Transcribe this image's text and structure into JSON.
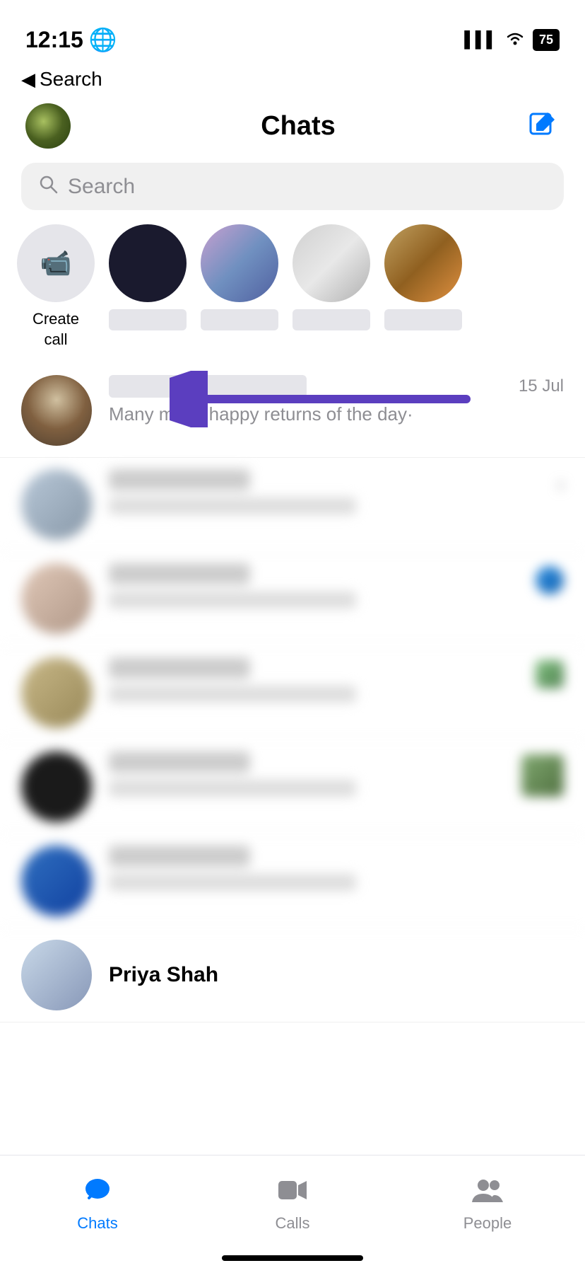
{
  "statusBar": {
    "time": "12:15",
    "globeIcon": "🌐",
    "battery": "75"
  },
  "backButton": {
    "label": "Search"
  },
  "header": {
    "title": "Chats",
    "composeLabel": "compose"
  },
  "searchBar": {
    "placeholder": "Search"
  },
  "storyRow": {
    "createCall": {
      "label": "Create\ncall"
    },
    "stories": [
      {
        "id": 1,
        "colorClass": "av1"
      },
      {
        "id": 2,
        "colorClass": "av2"
      },
      {
        "id": 3,
        "colorClass": "av3"
      },
      {
        "id": 4,
        "colorClass": "av4"
      }
    ]
  },
  "chatItems": [
    {
      "id": 1,
      "nameBlur": true,
      "message": "Many many happy returns of the day·",
      "time": "15 Jul",
      "hasArrow": true
    }
  ],
  "blurredItems": [
    {
      "id": 2,
      "avatarColor": "#b8d0e8"
    },
    {
      "id": 3,
      "avatarColor": "#c8b8a8"
    },
    {
      "id": 4,
      "avatarColor": "#d8c898"
    },
    {
      "id": 5,
      "avatarColor": "#a8b8c8"
    }
  ],
  "priyaRow": {
    "name": "Priya Shah"
  },
  "bottomNav": {
    "items": [
      {
        "id": "chats",
        "label": "Chats",
        "active": true
      },
      {
        "id": "calls",
        "label": "Calls",
        "active": false
      },
      {
        "id": "people",
        "label": "People",
        "active": false
      }
    ]
  },
  "arrow": {
    "color": "#5B3EBF"
  }
}
